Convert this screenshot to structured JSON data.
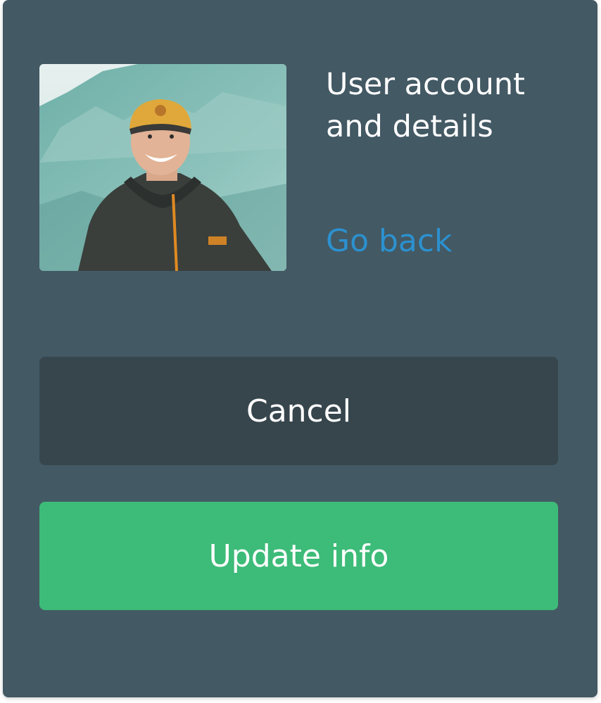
{
  "profile": {
    "title": "User account and details",
    "back_link_label": "Go back",
    "avatar_icon": "user-photo"
  },
  "actions": {
    "cancel_label": "Cancel",
    "update_label": "Update info"
  },
  "colors": {
    "card_background": "#435964",
    "link": "#2c91cf",
    "cancel_button": "#37464d",
    "update_button": "#3dbb78",
    "text": "#ffffff"
  }
}
